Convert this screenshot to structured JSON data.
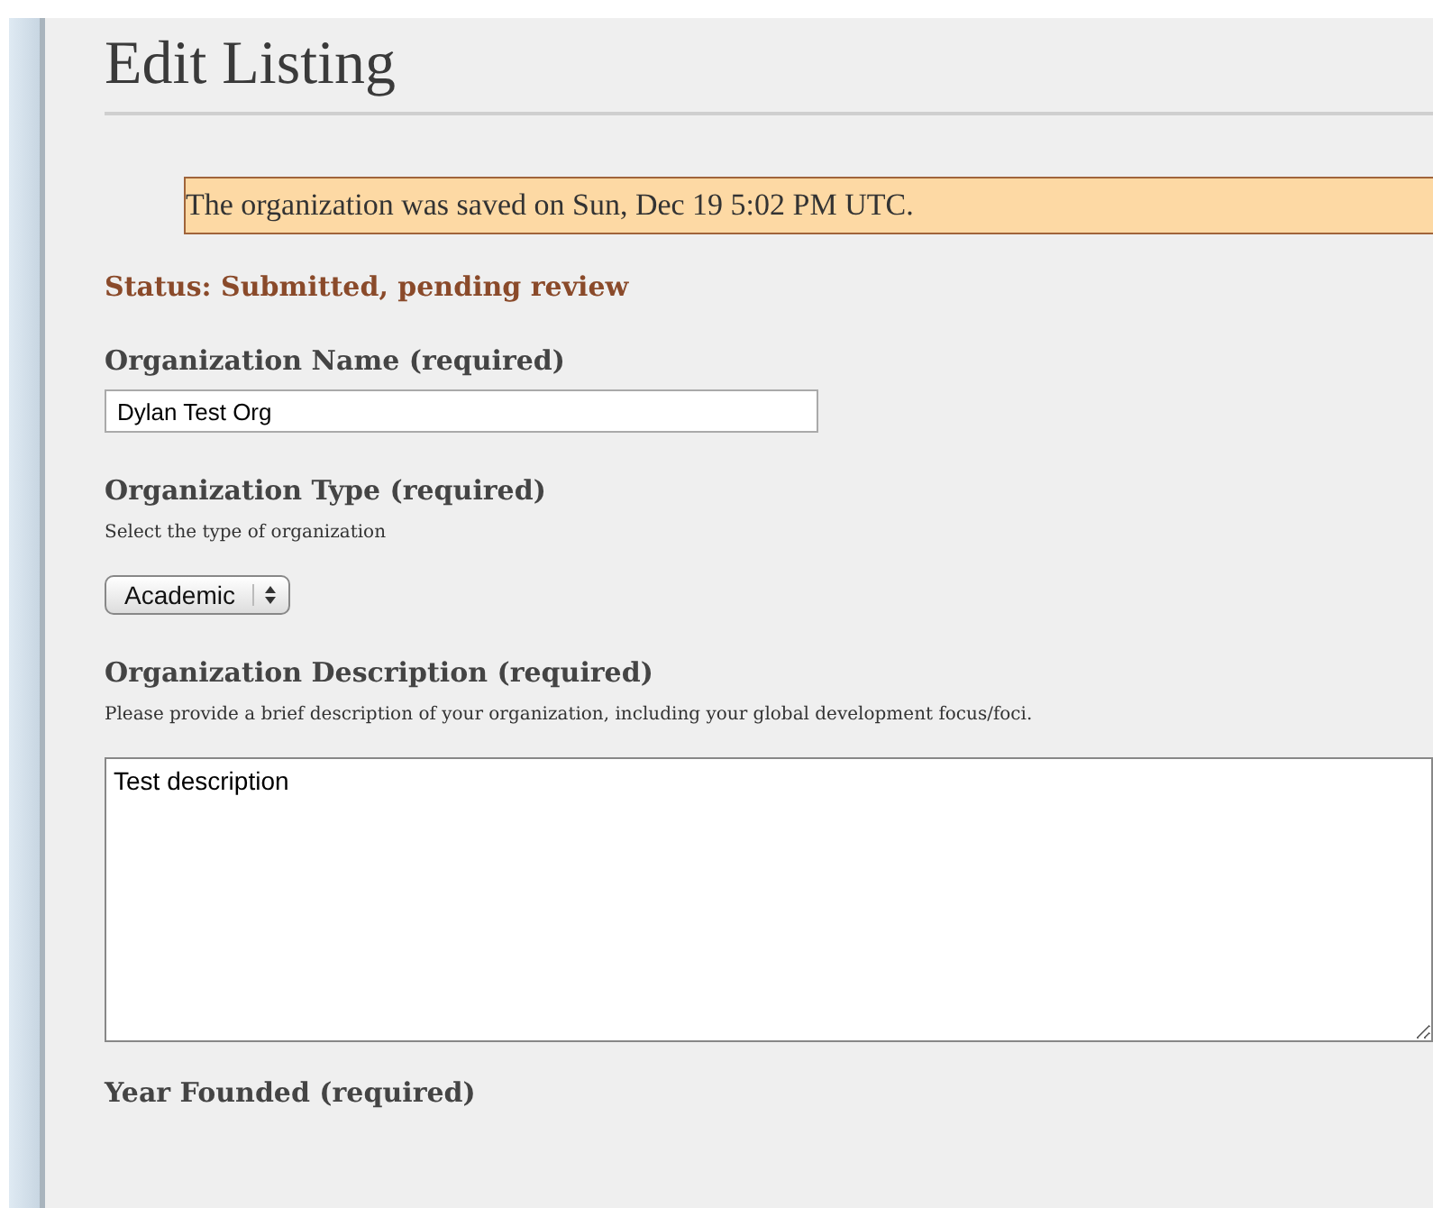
{
  "page": {
    "title": "Edit Listing"
  },
  "notice": "The organization was saved on Sun, Dec 19 5:02 PM UTC.",
  "status": "Status: Submitted, pending review",
  "fields": [
    {
      "kind": "text",
      "label": "Organization Name (required)",
      "value": "Dylan Test Org"
    },
    {
      "kind": "select",
      "label": "Organization Type (required)",
      "hint": "Select the type of organization",
      "value": "Academic"
    },
    {
      "kind": "textarea",
      "label": "Organization Description (required)",
      "hint": "Please provide a brief description of your organization, including your global development focus/foci.",
      "value": "Test description"
    },
    {
      "kind": "cut",
      "label": "Year Founded (required)"
    }
  ]
}
